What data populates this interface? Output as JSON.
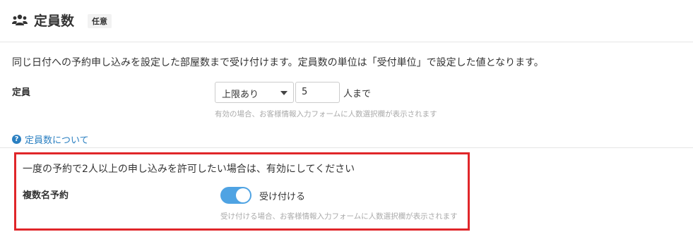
{
  "header": {
    "icon": "users-icon",
    "title": "定員数",
    "badge": "任意"
  },
  "description": "同じ日付への予約申し込みを設定した部屋数まで受け付けます。定員数の単位は「受付単位」で設定した値となります。",
  "capacity": {
    "label": "定員",
    "select_value": "上限あり",
    "number_value": "5",
    "unit": "人まで",
    "hint": "有効の場合、お客様情報入力フォームに人数選択欄が表示されます"
  },
  "help_link": {
    "icon": "question-circle-icon",
    "label": "定員数について"
  },
  "multi": {
    "description": "一度の予約で2人以上の申し込みを許可したい場合は、有効にしてください",
    "label": "複数名予約",
    "toggle_on": true,
    "toggle_text": "受け付ける",
    "hint": "受け付ける場合、お客様情報入力フォームに人数選択欄が表示されます"
  },
  "colors": {
    "accent": "#4fa3e3",
    "link": "#2a7fc1",
    "highlight": "#e0262a",
    "hint": "#aaaaaa"
  }
}
